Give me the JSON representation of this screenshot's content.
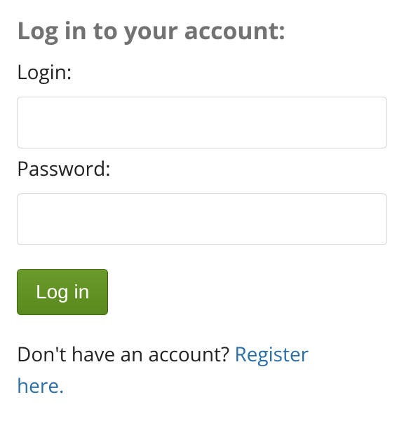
{
  "title": "Log in to your account:",
  "form": {
    "login_label": "Login:",
    "login_value": "",
    "password_label": "Password:",
    "password_value": "",
    "submit_label": "Log in"
  },
  "signup": {
    "prompt": "Don't have an account? ",
    "link_text": "Register here."
  }
}
